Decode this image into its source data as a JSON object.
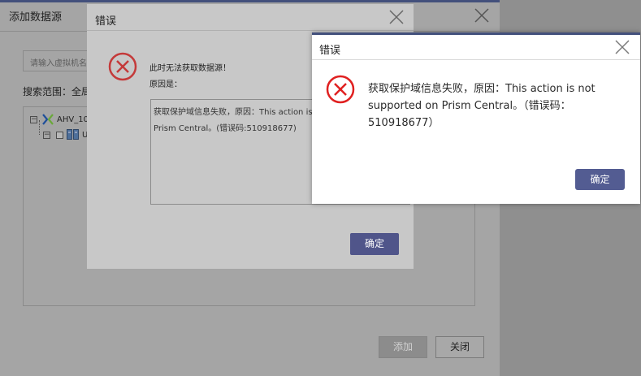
{
  "base_dialog": {
    "title": "添加数据源",
    "search_placeholder": "请输入虚拟机名",
    "range_label": "搜索范围：全局",
    "tree": {
      "node1": {
        "expander": "−",
        "icon": "nutanix-x-icon",
        "label": "AHV_10"
      },
      "node2": {
        "expander": "−",
        "icon": "cluster-icon",
        "label": "U"
      }
    },
    "add_label": "添加",
    "close_label": "关闭"
  },
  "mid_dialog": {
    "title": "错误",
    "line1": "此时无法获取数据源！",
    "line2": "原因是：",
    "detail": "获取保护域信息失败，原因：This action is not supported on Prism Central。(错误码:510918677)",
    "ok_label": "确定"
  },
  "front_dialog": {
    "title": "错误",
    "message": "获取保护域信息失败，原因：This action is not supported on Prism Central。（错误码：510918677）",
    "ok_label": "确定"
  },
  "colors": {
    "accent": "#50558a",
    "error_red": "#e02020",
    "title_bar_line": "#43507c",
    "overlay_gray": "#8f8f8f"
  }
}
